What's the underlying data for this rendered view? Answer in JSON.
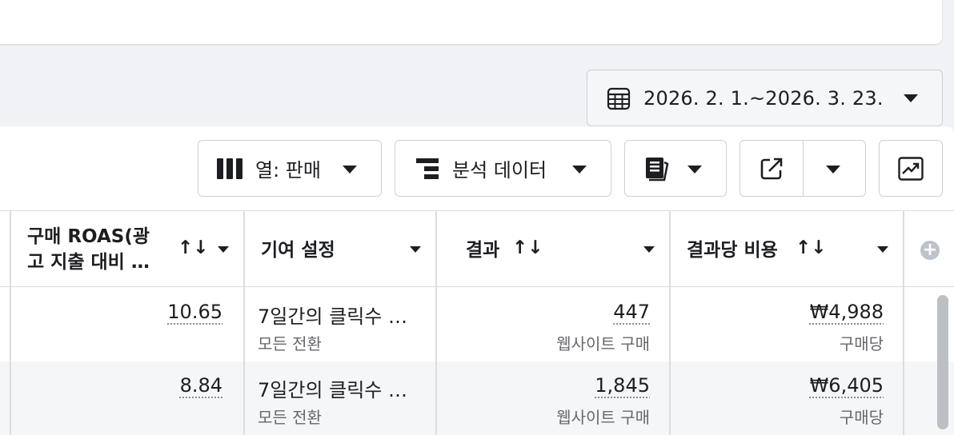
{
  "date_range": {
    "label": "2026. 2. 1.~2026. 3. 23.",
    "icon": "calendar-icon"
  },
  "toolbar": {
    "columns_label": "열: 판매",
    "breakdown_label": "분석 데이터",
    "reports_icon": "reports-icon",
    "export_icon": "export-icon",
    "chart_icon": "chart-icon"
  },
  "table": {
    "headers": {
      "roas_line1": "구매 ROAS(광",
      "roas_line2": "고 지출 대비 …",
      "attribution": "기여 설정",
      "results": "결과",
      "cost_per_result": "결과당 비용"
    },
    "sort_glyph": "↑↓",
    "rows": [
      {
        "roas": "10.65",
        "attribution_main": "7일간의 클릭수 …",
        "attribution_sub": "모든 전환",
        "results": "447",
        "results_sub": "웹사이트 구매",
        "cost": "₩4,988",
        "cost_sub": "구매당"
      },
      {
        "roas": "8.84",
        "attribution_main": "7일간의 클릭수 …",
        "attribution_sub": "모든 전환",
        "results": "1,845",
        "results_sub": "웹사이트 구매",
        "cost": "₩6,405",
        "cost_sub": "구매당"
      }
    ]
  }
}
